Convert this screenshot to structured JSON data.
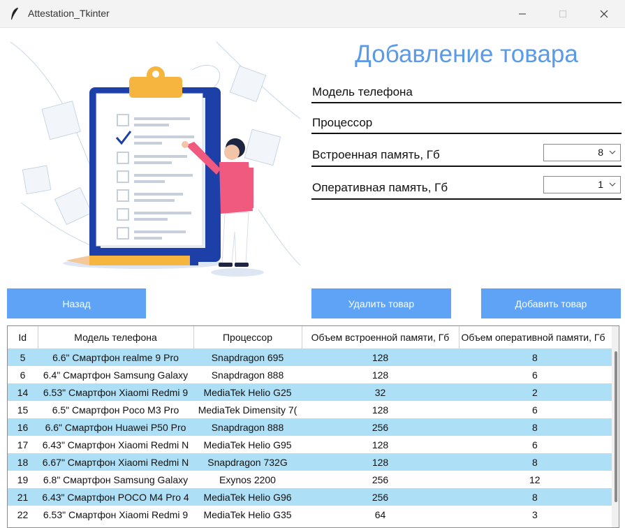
{
  "window": {
    "title": "Attestation_Tkinter"
  },
  "form": {
    "title": "Добавление товара",
    "model_label": "Модель телефона",
    "cpu_label": "Процессор",
    "storage_label": "Встроенная память, Гб",
    "storage_value": "8",
    "ram_label": "Оперативная память, Гб",
    "ram_value": "1"
  },
  "buttons": {
    "back": "Назад",
    "delete": "Удалить товар",
    "add": "Добавить товар"
  },
  "colors": {
    "accent": "#5ea3f6",
    "title": "#5b9ae8",
    "row_highlight": "#ade0f7"
  },
  "table": {
    "columns": [
      "Id",
      "Модель телефона",
      "Процессор",
      "Объем встроенной памяти, Гб",
      "Объем оперативной памяти, Гб"
    ],
    "rows": [
      [
        "5",
        "6.6\" Смартфон realme 9 Pro",
        "Snapdragon 695",
        "128",
        "8"
      ],
      [
        "6",
        "6.4\" Смартфон Samsung Galaxy",
        "Snapdragon 888",
        "128",
        "6"
      ],
      [
        "14",
        "6.53\" Смартфон Xiaomi Redmi 9",
        "MediaTek Helio G25",
        "32",
        "2"
      ],
      [
        "15",
        "6.5\" Смартфон Poco M3 Pro",
        "MediaTek Dimensity 7(",
        "128",
        "6"
      ],
      [
        "16",
        "6.6\" Смартфон Huawei P50 Pro",
        "Snapdragon 888",
        "256",
        "8"
      ],
      [
        "17",
        "6.43\" Смартфон Xiaomi Redmi N",
        "MediaTek Helio G95",
        "128",
        "6"
      ],
      [
        "18",
        "6.67\" Смартфон Xiaomi Redmi N",
        "Snapdragon 732G",
        "128",
        "8"
      ],
      [
        "19",
        "6.8\" Смартфон Samsung Galaxy",
        "Exynos 2200",
        "256",
        "12"
      ],
      [
        "21",
        "6.43\" Смартфон POCO M4 Pro 4",
        "MediaTek Helio G96",
        "256",
        "8"
      ],
      [
        "22",
        "6.53\" Смартфон Xiaomi Redmi 9",
        "MediaTek Helio G35",
        "64",
        "3"
      ]
    ]
  }
}
